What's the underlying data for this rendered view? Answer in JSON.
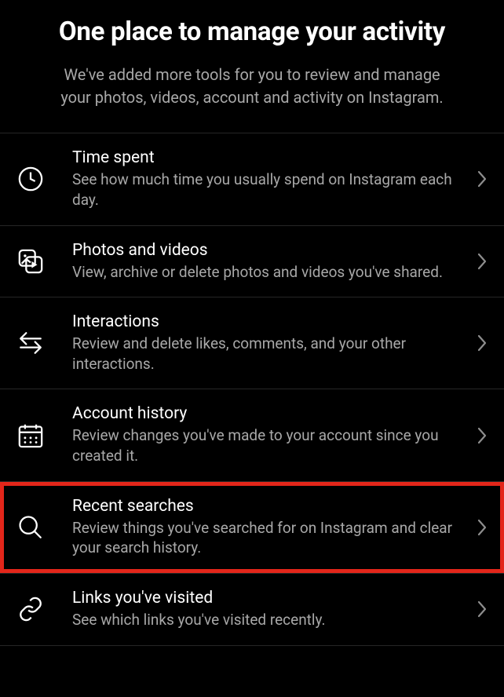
{
  "header": {
    "title": "One place to manage your activity",
    "subtitle": "We've added more tools for you to review and manage your photos, videos, account and activity on Instagram."
  },
  "items": [
    {
      "title": "Time spent",
      "desc": "See how much time you usually spend on Instagram each day."
    },
    {
      "title": "Photos and videos",
      "desc": "View, archive or delete photos and videos you've shared."
    },
    {
      "title": "Interactions",
      "desc": "Review and delete likes, comments, and your other interactions."
    },
    {
      "title": "Account history",
      "desc": "Review changes you've made to your account since you created it."
    },
    {
      "title": "Recent searches",
      "desc": "Review things you've searched for on Instagram and clear your search history."
    },
    {
      "title": "Links you've visited",
      "desc": "See which links you've visited recently."
    }
  ]
}
